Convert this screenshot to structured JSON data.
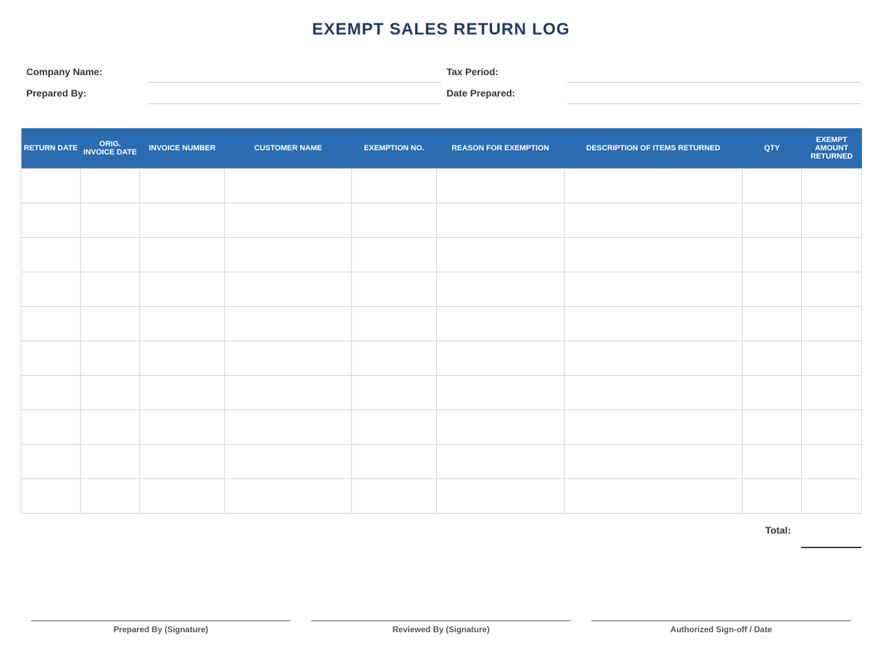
{
  "title": "EXEMPT SALES RETURN LOG",
  "fields": {
    "company_name": "Company Name:",
    "tax_period": "Tax Period:",
    "prepared_by": "Prepared By:",
    "date_prepared": "Date Prepared:"
  },
  "table": {
    "headers": [
      "RETURN DATE",
      "ORIG. INVOICE DATE",
      "INVOICE NUMBER",
      "CUSTOMER NAME",
      "EXEMPTION NO.",
      "REASON FOR EXEMPTION",
      "DESCRIPTION OF ITEMS RETURNED",
      "QTY",
      "EXEMPT AMOUNT RETURNED"
    ],
    "rows": [
      [
        "",
        "",
        "",
        "",
        "",
        "",
        "",
        "",
        ""
      ],
      [
        "",
        "",
        "",
        "",
        "",
        "",
        "",
        "",
        ""
      ],
      [
        "",
        "",
        "",
        "",
        "",
        "",
        "",
        "",
        ""
      ],
      [
        "",
        "",
        "",
        "",
        "",
        "",
        "",
        "",
        ""
      ],
      [
        "",
        "",
        "",
        "",
        "",
        "",
        "",
        "",
        ""
      ],
      [
        "",
        "",
        "",
        "",
        "",
        "",
        "",
        "",
        ""
      ],
      [
        "",
        "",
        "",
        "",
        "",
        "",
        "",
        "",
        ""
      ],
      [
        "",
        "",
        "",
        "",
        "",
        "",
        "",
        "",
        ""
      ],
      [
        "",
        "",
        "",
        "",
        "",
        "",
        "",
        "",
        ""
      ],
      [
        "",
        "",
        "",
        "",
        "",
        "",
        "",
        "",
        ""
      ]
    ]
  },
  "total_label": "Total:",
  "signatures": {
    "prepared": "Prepared By (Signature)",
    "reviewed": "Reviewed By (Signature)",
    "authorized": "Authorized Sign-off / Date"
  },
  "colors": {
    "title": "#1f3a5f",
    "header_bg": "#2b6cb0",
    "grid": "#d0d4d9"
  }
}
